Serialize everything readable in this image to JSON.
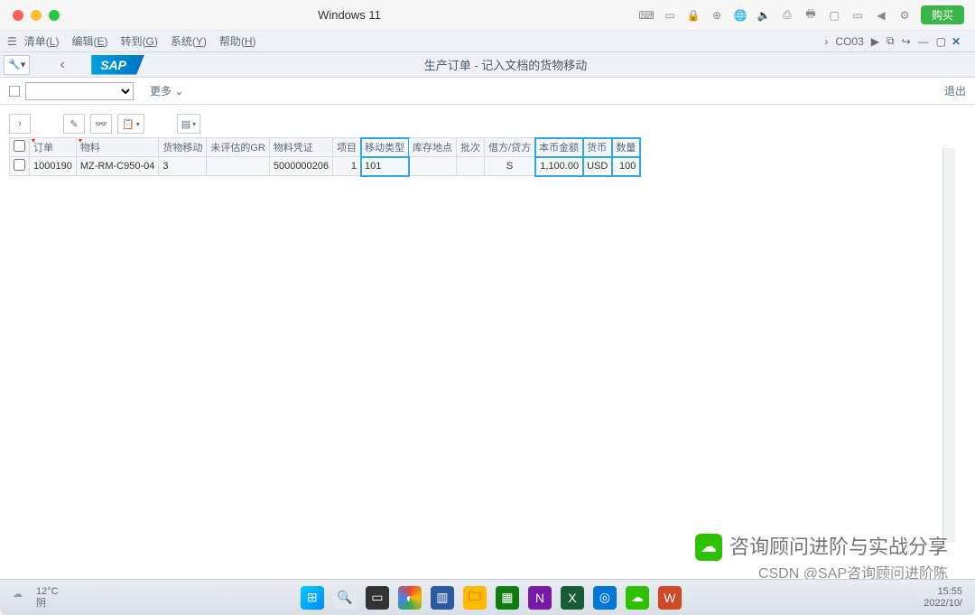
{
  "window": {
    "title": "Windows 11",
    "buy": "购买"
  },
  "menubar": {
    "items": [
      {
        "pre": "清单(",
        "u": "L",
        "post": ")"
      },
      {
        "pre": "编辑(",
        "u": "E",
        "post": ")"
      },
      {
        "pre": "转到(",
        "u": "G",
        "post": ")"
      },
      {
        "pre": "系统(",
        "u": "Y",
        "post": ")"
      },
      {
        "pre": "帮助(",
        "u": "H",
        "post": ")"
      }
    ],
    "tcode": "CO03"
  },
  "header": {
    "sap": "SAP",
    "subtitle": "生产订单 - 记入文档的货物移动"
  },
  "cmdbar": {
    "more": "更多",
    "exit": "退出"
  },
  "table": {
    "columns": [
      "订单",
      "物料",
      "货物移动",
      "未评估的GR",
      "物料凭证",
      "项目",
      "移动类型",
      "库存地点",
      "批次",
      "借方/贷方",
      "本币金额",
      "货币",
      "数量"
    ],
    "rows": [
      {
        "order": "1000190",
        "material": "MZ-RM-C950-04",
        "goods_mvmt": "3",
        "unval_gr": "",
        "mat_doc": "5000000206",
        "item": "1",
        "mvt_type": "101",
        "stor_loc": "",
        "batch": "",
        "dc": "S",
        "amount": "1,100.00",
        "curr": "USD",
        "qty": "100"
      }
    ]
  },
  "watermark": {
    "line1": "咨询顾问进阶与实战分享",
    "line2": "CSDN @SAP咨询顾问进阶陈"
  },
  "taskbar": {
    "weather_temp": "12°C",
    "weather_desc": "阴",
    "clock_time": "15:55",
    "clock_date": "2022/10/"
  }
}
